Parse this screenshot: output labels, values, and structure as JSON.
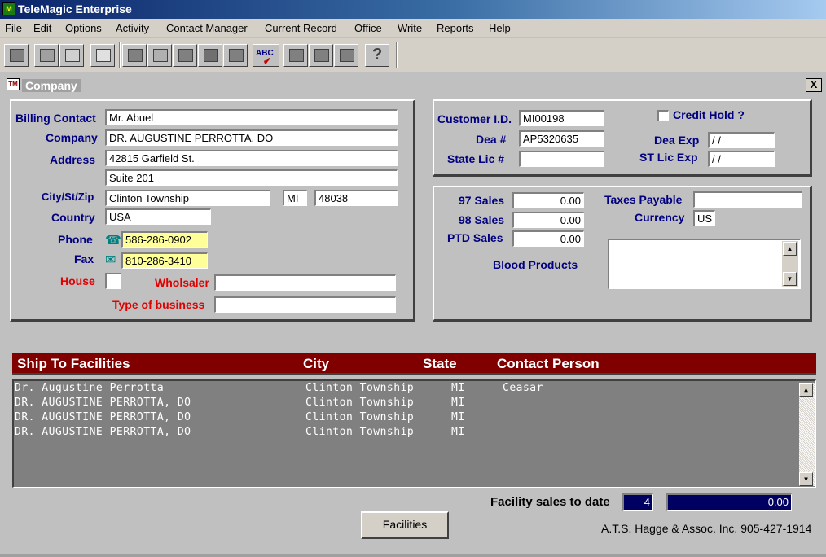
{
  "app": {
    "title": "TeleMagic Enterprise",
    "icon_text": "M"
  },
  "menu": [
    "File",
    "Edit",
    "Options",
    "Activity",
    "Contact Manager",
    "Current Record",
    "Office",
    "Write",
    "Reports",
    "Help"
  ],
  "toolbar": {
    "spell_check_label": "ABC",
    "help_label": "?"
  },
  "document": {
    "title": "Company",
    "icon_text": "TM",
    "close_label": "X"
  },
  "contact": {
    "billing_contact_label": "Billing Contact",
    "billing_contact": "Mr. Abuel",
    "company_label": "Company",
    "company": "DR. AUGUSTINE PERROTTA, DO",
    "address_label": "Address",
    "address1": "42815 Garfield St.",
    "address2": "Suite 201",
    "city_label": "City/St/Zip",
    "city": "Clinton Township",
    "state": "MI",
    "zip": "48038",
    "country_label": "Country",
    "country": "USA",
    "phone_label": "Phone",
    "phone": "586-286-0902",
    "fax_label": "Fax",
    "fax": "810-286-3410",
    "house_label": "House",
    "wholesaler_label": "Wholsaler",
    "wholesaler": "",
    "business_type_label": "Type of business",
    "business_type": ""
  },
  "license": {
    "customer_id_label": "Customer I.D.",
    "customer_id": "MI00198",
    "dea_label": "Dea #",
    "dea": "AP5320635",
    "state_lic_label": "State Lic #",
    "state_lic": "",
    "credit_hold_label": "Credit Hold ?",
    "dea_exp_label": "Dea Exp",
    "dea_exp": " /  /",
    "st_lic_exp_label": "ST Lic Exp",
    "st_lic_exp": " /  /"
  },
  "sales": {
    "sales97_label": "97 Sales",
    "sales97": "0.00",
    "sales98_label": "98 Sales",
    "sales98": "0.00",
    "ptd_label": "PTD Sales",
    "ptd": "0.00",
    "taxes_label": "Taxes Payable",
    "taxes": "",
    "currency_label": "Currency",
    "currency": "US",
    "blood_label": "Blood Products"
  },
  "ship_to": {
    "headers": [
      "Ship To Facilities",
      "City",
      "State",
      "Contact Person"
    ],
    "rows": [
      [
        "Dr. Augustine Perrotta",
        "Clinton Township",
        "MI",
        "Ceasar"
      ],
      [
        "DR. AUGUSTINE PERROTTA, DO",
        "Clinton Township",
        "MI",
        ""
      ],
      [
        "DR. AUGUSTINE PERROTTA, DO",
        "Clinton Township",
        "MI",
        ""
      ],
      [
        "DR. AUGUSTINE PERROTTA, DO",
        "Clinton Township",
        "MI",
        ""
      ]
    ]
  },
  "facility": {
    "sales_label": "Facility sales to date",
    "count": "4",
    "amount": "0.00",
    "button_label": "Facilities"
  },
  "footer": {
    "credit": "A.T.S. Hagge & Assoc. Inc. 905-427-1914"
  }
}
